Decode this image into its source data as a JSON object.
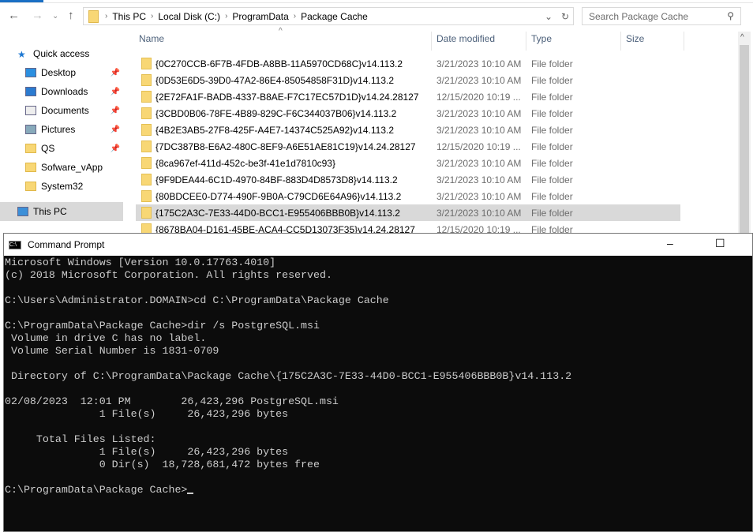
{
  "explorer": {
    "breadcrumb": [
      "This PC",
      "Local Disk (C:)",
      "ProgramData",
      "Package Cache"
    ],
    "search_placeholder": "Search Package Cache",
    "columns": {
      "name": "Name",
      "date": "Date modified",
      "type": "Type",
      "size": "Size"
    },
    "sidebar": [
      {
        "label": "Quick access",
        "icon": "star-icon"
      },
      {
        "label": "Desktop",
        "icon": "desktop-icon",
        "pinned": true
      },
      {
        "label": "Downloads",
        "icon": "download-icon",
        "pinned": true
      },
      {
        "label": "Documents",
        "icon": "document-icon",
        "pinned": true
      },
      {
        "label": "Pictures",
        "icon": "picture-icon",
        "pinned": true
      },
      {
        "label": "QS",
        "icon": "folder-icon",
        "pinned": true
      },
      {
        "label": "Sofware_vApp",
        "icon": "folder-icon"
      },
      {
        "label": "System32",
        "icon": "folder-icon"
      },
      {
        "label": "This PC",
        "icon": "computer-icon"
      }
    ],
    "files": [
      {
        "name": "{0C270CCB-6F7B-4FDB-A8BB-11A5970CD68C}v14.113.2",
        "date": "3/21/2023 10:10 AM",
        "type": "File folder"
      },
      {
        "name": "{0D53E6D5-39D0-47A2-86E4-85054858F31D}v14.113.2",
        "date": "3/21/2023 10:10 AM",
        "type": "File folder"
      },
      {
        "name": "{2E72FA1F-BADB-4337-B8AE-F7C17EC57D1D}v14.24.28127",
        "date": "12/15/2020 10:19 ...",
        "type": "File folder"
      },
      {
        "name": "{3CBD0B06-78FE-4B89-829C-F6C344037B06}v14.113.2",
        "date": "3/21/2023 10:10 AM",
        "type": "File folder"
      },
      {
        "name": "{4B2E3AB5-27F8-425F-A4E7-14374C525A92}v14.113.2",
        "date": "3/21/2023 10:10 AM",
        "type": "File folder"
      },
      {
        "name": "{7DC387B8-E6A2-480C-8EF9-A6E51AE81C19}v14.24.28127",
        "date": "12/15/2020 10:19 ...",
        "type": "File folder"
      },
      {
        "name": "{8ca967ef-411d-452c-be3f-41e1d7810c93}",
        "date": "3/21/2023 10:10 AM",
        "type": "File folder"
      },
      {
        "name": "{9F9DEA44-6C1D-4970-84BF-883D4D8573D8}v14.113.2",
        "date": "3/21/2023 10:10 AM",
        "type": "File folder"
      },
      {
        "name": "{80BDCEE0-D774-490F-9B0A-C79CD6E64A96}v14.113.2",
        "date": "3/21/2023 10:10 AM",
        "type": "File folder"
      },
      {
        "name": "{175C2A3C-7E33-44D0-BCC1-E955406BBB0B}v14.113.2",
        "date": "3/21/2023 10:10 AM",
        "type": "File folder",
        "selected": true
      },
      {
        "name": "{8678BA04-D161-45BE-ACA4-CC5D13073F35}v14.24.28127",
        "date": "12/15/2020 10:19 ...",
        "type": "File folder"
      }
    ]
  },
  "cmd": {
    "title": "Command Prompt",
    "lines": [
      "Microsoft Windows [Version 10.0.17763.4010]",
      "(c) 2018 Microsoft Corporation. All rights reserved.",
      "",
      "C:\\Users\\Administrator.DOMAIN>cd C:\\ProgramData\\Package Cache",
      "",
      "C:\\ProgramData\\Package Cache>dir /s PostgreSQL.msi",
      " Volume in drive C has no label.",
      " Volume Serial Number is 1831-0709",
      "",
      " Directory of C:\\ProgramData\\Package Cache\\{175C2A3C-7E33-44D0-BCC1-E955406BBB0B}v14.113.2",
      "",
      "02/08/2023  12:01 PM        26,423,296 PostgreSQL.msi",
      "               1 File(s)     26,423,296 bytes",
      "",
      "     Total Files Listed:",
      "               1 File(s)     26,423,296 bytes",
      "               0 Dir(s)  18,728,681,472 bytes free",
      "",
      "C:\\ProgramData\\Package Cache>"
    ]
  }
}
